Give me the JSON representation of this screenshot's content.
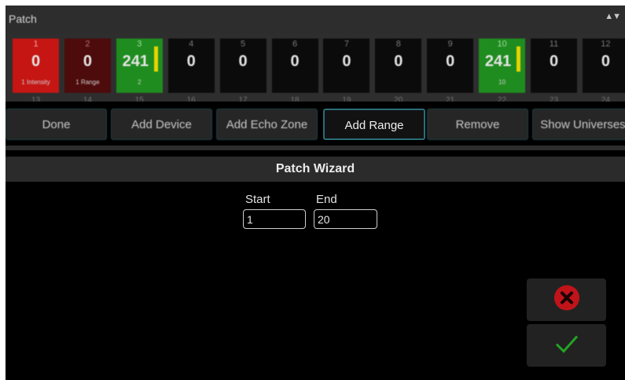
{
  "window": {
    "title": "Patch",
    "scroll_arrows": "▲▼"
  },
  "channels": [
    {
      "num": "1",
      "value": "0",
      "sub": "1 Intensity",
      "style": "red"
    },
    {
      "num": "2",
      "value": "0",
      "sub": "1 Range",
      "style": "dred"
    },
    {
      "num": "3",
      "value": "241",
      "sub": "2",
      "style": "green",
      "level": 0.6
    },
    {
      "num": "4",
      "value": "0",
      "sub": "",
      "style": ""
    },
    {
      "num": "5",
      "value": "0",
      "sub": "",
      "style": ""
    },
    {
      "num": "6",
      "value": "0",
      "sub": "",
      "style": ""
    },
    {
      "num": "7",
      "value": "0",
      "sub": "",
      "style": ""
    },
    {
      "num": "8",
      "value": "0",
      "sub": "",
      "style": ""
    },
    {
      "num": "9",
      "value": "0",
      "sub": "",
      "style": ""
    },
    {
      "num": "10",
      "value": "241",
      "sub": "10",
      "style": "green",
      "level": 0.6
    },
    {
      "num": "11",
      "value": "0",
      "sub": "",
      "style": ""
    },
    {
      "num": "12",
      "value": "0",
      "sub": "",
      "style": ""
    }
  ],
  "addresses": [
    "13",
    "14",
    "15",
    "16",
    "17",
    "18",
    "19",
    "20",
    "21",
    "22",
    "23",
    "24"
  ],
  "tabs": [
    {
      "label": "Done",
      "active": false
    },
    {
      "label": "Add Device",
      "active": false
    },
    {
      "label": "Add Echo Zone",
      "active": false
    },
    {
      "label": "Add Range",
      "active": true
    },
    {
      "label": "Remove",
      "active": false
    },
    {
      "label": "Show Universes",
      "active": false
    }
  ],
  "wizard": {
    "title": "Patch Wizard",
    "start_label": "Start",
    "start_value": "1",
    "end_label": "End",
    "end_value": "20"
  },
  "actions": {
    "cancel_icon": "close-circle-icon",
    "confirm_icon": "checkmark-icon"
  },
  "colors": {
    "channel_red": "#c51614",
    "channel_dark_red": "#4e0b0b",
    "channel_green": "#1f8c1f",
    "level_bar": "#e8d400",
    "tab_accent": "#2a6d78",
    "cancel_red": "#c0141a",
    "confirm_green": "#22a622"
  }
}
